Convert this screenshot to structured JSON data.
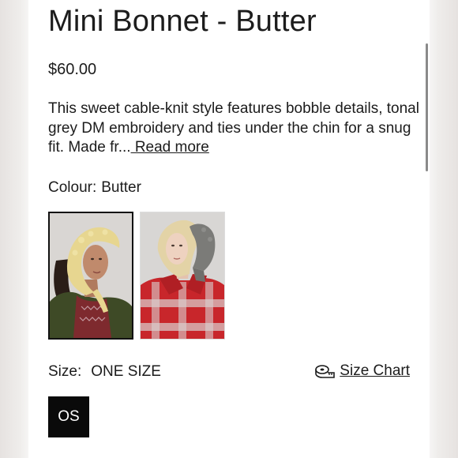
{
  "product": {
    "title": "Mini Bonnet - Butter",
    "price": "$60.00",
    "description": "This sweet cable-knit style features bobble details, tonal grey DM embroidery and ties under the chin for a snug fit. Made fr...",
    "read_more": " Read more"
  },
  "colour": {
    "label": "Colour:",
    "value": "Butter",
    "swatches": [
      {
        "name": "Butter",
        "selected": true
      },
      {
        "name": "Grey",
        "selected": false
      }
    ]
  },
  "size": {
    "label": "Size:",
    "value": "ONE SIZE",
    "chart_label": "Size Chart",
    "chart_icon": "measuring-tape-icon",
    "options": [
      "OS"
    ],
    "selected": "OS"
  },
  "colors": {
    "selected_size_bg": "#0a0a0a",
    "page_bg": "#ffffff"
  }
}
